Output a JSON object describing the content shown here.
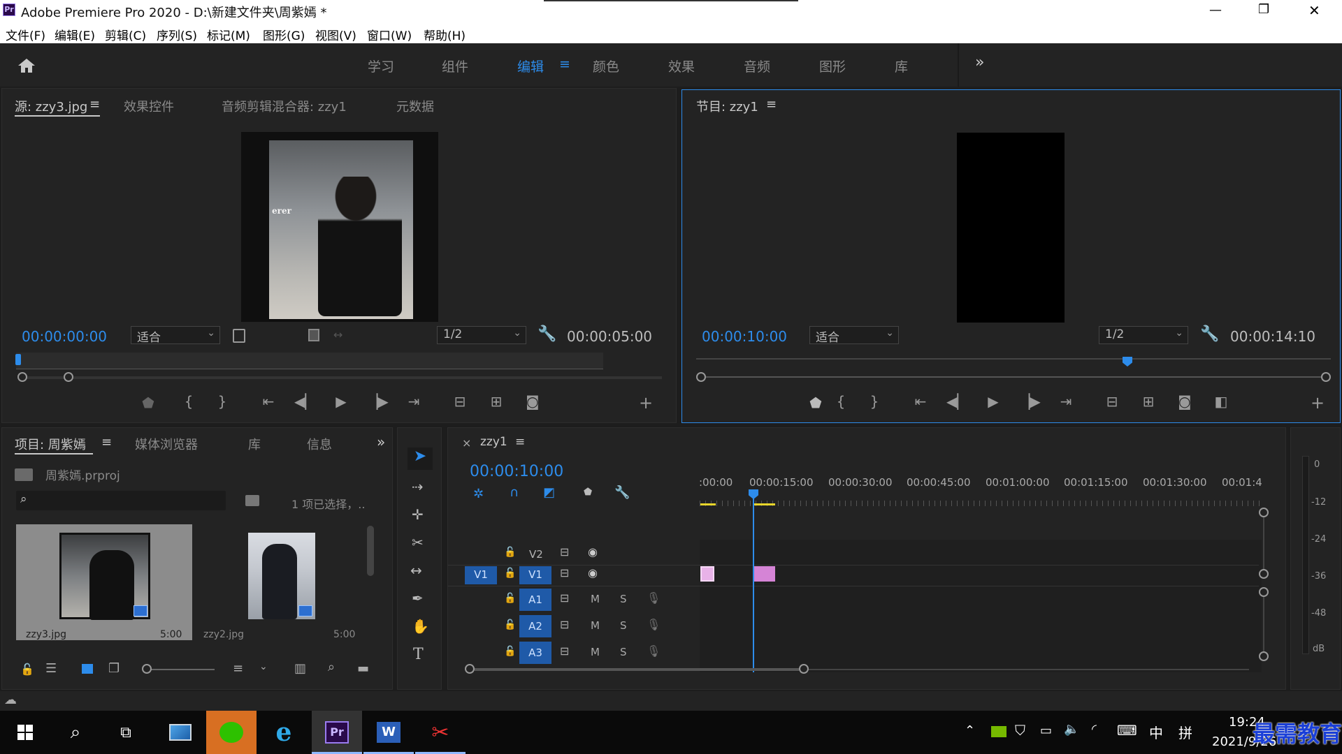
{
  "app": {
    "title": "Adobe Premiere Pro 2020 - D:\\新建文件夹\\周紫嫣 *",
    "icon": "Pr"
  },
  "window_controls": {
    "minimize": "—",
    "maximize": "❐",
    "close": "✕"
  },
  "menu": [
    "文件(F)",
    "编辑(E)",
    "剪辑(C)",
    "序列(S)",
    "标记(M)",
    "图形(G)",
    "视图(V)",
    "窗口(W)",
    "帮助(H)"
  ],
  "workspaces": {
    "items": [
      "学习",
      "组件",
      "编辑",
      "颜色",
      "效果",
      "音频",
      "图形",
      "库"
    ],
    "active": "编辑",
    "menu_icon": "≡",
    "more": "»"
  },
  "source_panel": {
    "tabs": [
      "源: zzy3.jpg",
      "效果控件",
      "音频剪辑混合器: zzy1",
      "元数据"
    ],
    "menu_icon": "≡",
    "image_text": "erer",
    "timecode": "00:00:00:00",
    "fit": "适合",
    "resolution": "1/2",
    "duration": "00:00:05:00"
  },
  "program_panel": {
    "title": "节目: zzy1",
    "menu_icon": "≡",
    "timecode": "00:00:10:00",
    "fit": "适合",
    "resolution": "1/2",
    "duration": "00:00:14:10"
  },
  "project_panel": {
    "tabs": [
      "项目: 周紫嫣",
      "媒体浏览器",
      "库",
      "信息"
    ],
    "menu_icon": "≡",
    "more": "»",
    "project_file": "周紫嫣.prproj",
    "selection_text": "1 项已选择，..",
    "items": [
      {
        "name": "zzy3.jpg",
        "duration": "5:00"
      },
      {
        "name": "zzy2.jpg",
        "duration": "5:00"
      }
    ]
  },
  "timeline": {
    "sequence": "zzy1",
    "close": "×",
    "menu_icon": "≡",
    "timecode": "00:00:10:00",
    "ruler": [
      ":00:00",
      "00:00:15:00",
      "00:00:30:00",
      "00:00:45:00",
      "00:01:00:00",
      "00:01:15:00",
      "00:01:30:00",
      "00:01:4"
    ],
    "video_tracks": [
      {
        "name": "V2",
        "source": ""
      },
      {
        "name": "V1",
        "source": "V1"
      }
    ],
    "audio_tracks": [
      {
        "name": "A1",
        "m": "M",
        "s": "S"
      },
      {
        "name": "A2",
        "m": "M",
        "s": "S"
      },
      {
        "name": "A3",
        "m": "M",
        "s": "S"
      }
    ]
  },
  "audio_meter": {
    "labels": [
      "0",
      "-12",
      "-24",
      "-36",
      "-48",
      "dB"
    ]
  },
  "taskbar": {
    "time": "19:24",
    "date": "2021/9/26",
    "ime": "中",
    "ime2": "拼",
    "watermark": "最需教育"
  },
  "colors": {
    "accent": "#2d8ceb",
    "panel": "#232323",
    "bg": "#1d1d1d",
    "clip": "#d584d6",
    "yellow": "#e8d62b"
  }
}
